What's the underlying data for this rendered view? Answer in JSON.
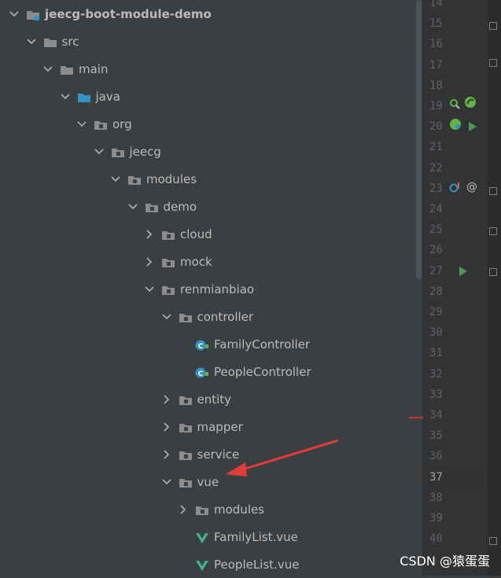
{
  "tree": {
    "rows": [
      {
        "label": "jeecg-boot-module-demo",
        "icon": "module-folder-icon",
        "expanded": true,
        "bold": true
      },
      {
        "label": "src",
        "icon": "folder-icon",
        "expanded": true
      },
      {
        "label": "main",
        "icon": "folder-icon",
        "expanded": true
      },
      {
        "label": "java",
        "icon": "source-root-folder-icon",
        "expanded": true
      },
      {
        "label": "org",
        "icon": "package-folder-icon",
        "expanded": true
      },
      {
        "label": "jeecg",
        "icon": "package-folder-icon",
        "expanded": true
      },
      {
        "label": "modules",
        "icon": "package-folder-icon",
        "expanded": true
      },
      {
        "label": "demo",
        "icon": "package-folder-icon",
        "expanded": true
      },
      {
        "label": "cloud",
        "icon": "package-folder-icon",
        "expanded": false
      },
      {
        "label": "mock",
        "icon": "package-folder-icon",
        "expanded": false
      },
      {
        "label": "renmianbiao",
        "icon": "package-folder-icon",
        "expanded": true
      },
      {
        "label": "controller",
        "icon": "package-folder-icon",
        "expanded": true
      },
      {
        "label": "FamilyController",
        "icon": "java-class-icon",
        "expanded": null
      },
      {
        "label": "PeopleController",
        "icon": "java-class-icon",
        "expanded": null
      },
      {
        "label": "entity",
        "icon": "package-folder-icon",
        "expanded": false
      },
      {
        "label": "mapper",
        "icon": "package-folder-icon",
        "expanded": false
      },
      {
        "label": "service",
        "icon": "package-folder-icon",
        "expanded": false
      },
      {
        "label": "vue",
        "icon": "package-folder-icon",
        "expanded": true
      },
      {
        "label": "modules",
        "icon": "package-folder-icon",
        "expanded": false
      },
      {
        "label": "FamilyList.vue",
        "icon": "vue-file-icon",
        "expanded": null
      },
      {
        "label": "PeopleList.vue",
        "icon": "vue-file-icon",
        "expanded": null
      }
    ]
  },
  "gutter": {
    "line_numbers": [
      "14",
      "15",
      "16",
      "17",
      "18",
      "19",
      "20",
      "21",
      "22",
      "23",
      "24",
      "25",
      "26",
      "27",
      "28",
      "29",
      "30",
      "31",
      "32",
      "33",
      "34",
      "35",
      "36",
      "37",
      "38",
      "39",
      "40"
    ],
    "current_line": "37"
  },
  "watermark": "CSDN @猿蛋蛋",
  "colors": {
    "panel_bg": "#3c3f41",
    "gutter_bg": "#313335",
    "text": "#bbbbbb",
    "folder": "#8c8c8c",
    "source_folder": "#3592c4",
    "class_badge": "#3592c4",
    "vue_green": "#41b883",
    "annotation_arrow": "#e83a3a"
  }
}
